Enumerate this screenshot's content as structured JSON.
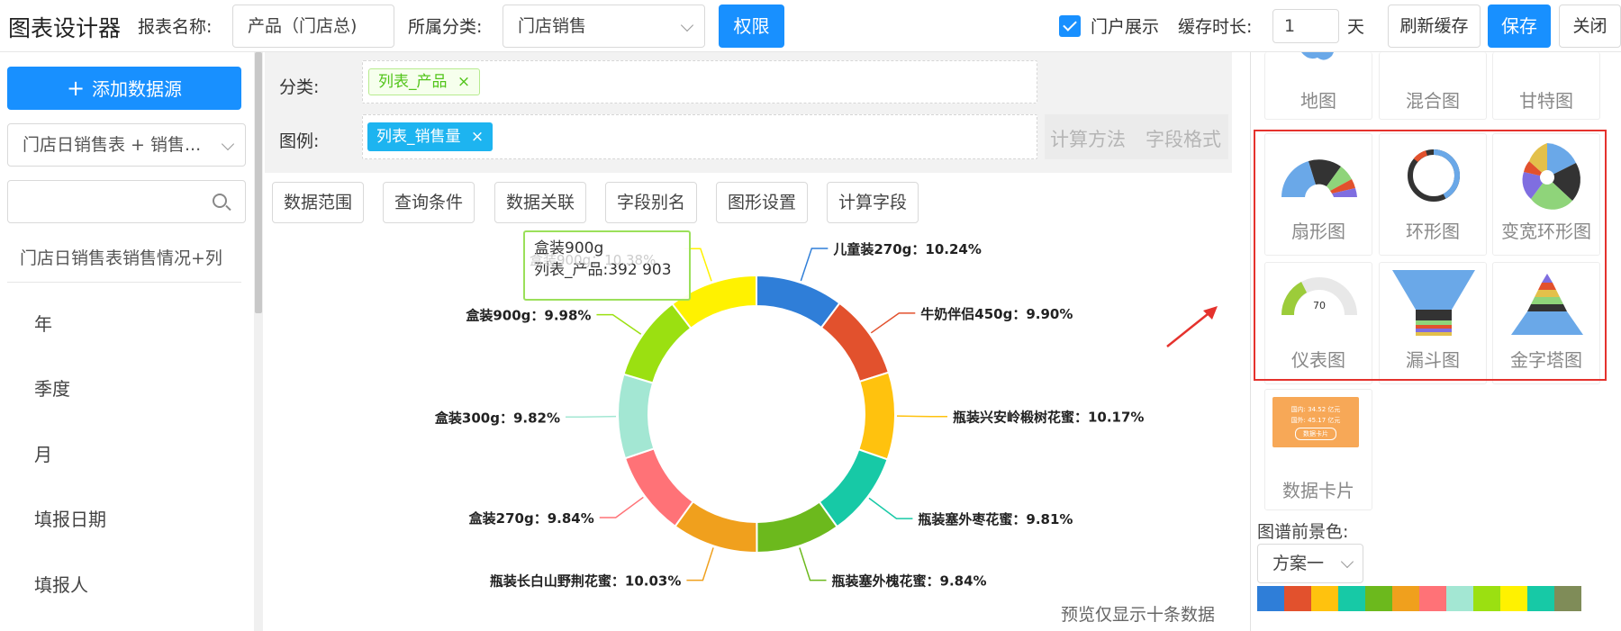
{
  "topbar": {
    "app_title": "图表设计器",
    "report_name_label": "报表名称:",
    "report_name_value": "产品（门店总)",
    "category_label": "所属分类:",
    "category_value": "门店销售",
    "permission_button": "权限",
    "portal_show_label": "门户展示",
    "cache_label": "缓存时长:",
    "cache_value": "1",
    "cache_unit": "天",
    "refresh_cache_button": "刷新缓存",
    "save_button": "保存",
    "close_button": "关闭"
  },
  "left_panel": {
    "add_source_button": "添加数据源",
    "add_icon": "plus-icon",
    "datasource_select": "门店日销售表 + 销售...",
    "search_placeholder": "",
    "table_title": "门店日销售表销售情况+列",
    "fields": [
      "年",
      "季度",
      "月",
      "填报日期",
      "填报人"
    ]
  },
  "config": {
    "category_label": "分类:",
    "category_tag": "列表_产品",
    "legend_label": "图例:",
    "legend_tag": "列表_销售量",
    "calc_method": "计算方法",
    "field_format": "字段格式",
    "tabs": [
      "数据范围",
      "查询条件",
      "数据关联",
      "字段别名",
      "图形设置",
      "计算字段"
    ]
  },
  "tooltip": {
    "title": "盒装900g",
    "value_line": "列表_产品:392 903",
    "ghost_text": "盒装900g：10.38%"
  },
  "footer_note": "预览仅显示十条数据",
  "right_panel": {
    "top_cards": [
      "地图",
      "混合图",
      "甘特图"
    ],
    "highlighted_cards": [
      "扇形图",
      "环形图",
      "变宽环形图",
      "仪表图",
      "漏斗图",
      "金字塔图"
    ],
    "data_card": "数据卡片",
    "data_card_lines": [
      "国内: 34.52 亿元",
      "国外: 45.17 亿元",
      "数据卡片"
    ],
    "gauge_value": "70",
    "palette_label": "图谱前景色:",
    "palette_scheme": "方案一",
    "palette_colors": [
      "#2f7ed8",
      "#e2512d",
      "#ffc20e",
      "#17c9a6",
      "#6cb91d",
      "#f0a01d",
      "#ff7277",
      "#a3e7d3",
      "#9be011",
      "#fff200",
      "#17c9a6",
      "#7f8c58"
    ],
    "highlight_color": "#e5322d"
  },
  "chart_data": {
    "type": "pie",
    "variant": "donut",
    "categories": [
      "儿童装270g",
      "牛奶伴侣450g",
      "瓶装兴安岭椴树花蜜",
      "瓶装塞外枣花蜜",
      "瓶装塞外槐花蜜",
      "瓶装长白山野荆花蜜",
      "盒装270g",
      "盒装300g",
      "盒装900g",
      "盒装900g"
    ],
    "values": [
      10.24,
      9.9,
      10.17,
      9.81,
      9.84,
      10.03,
      9.84,
      9.82,
      9.98,
      10.38
    ],
    "labels": [
      "儿童装270g：10.24%",
      "牛奶伴侣450g：9.90%",
      "瓶装兴安岭椴树花蜜：10.17%",
      "瓶装塞外枣花蜜：9.81%",
      "瓶装塞外槐花蜜：9.84%",
      "瓶装长白山野荆花蜜：10.03%",
      "盒装270g：9.84%",
      "盒装300g：9.82%",
      "盒装900g：9.98%",
      ""
    ],
    "colors": [
      "#2f7ed8",
      "#e2512d",
      "#ffc20e",
      "#17c9a6",
      "#6cb91d",
      "#f0a01d",
      "#ff7277",
      "#a3e7d3",
      "#9be011",
      "#fff200"
    ],
    "unit": "%"
  }
}
